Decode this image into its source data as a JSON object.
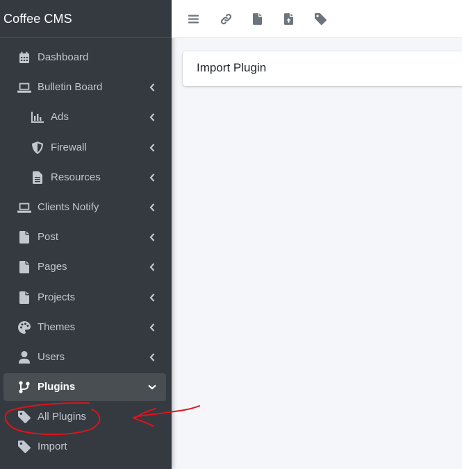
{
  "brand": {
    "title": "Coffee CMS"
  },
  "sidebar": {
    "items": [
      {
        "label": "Dashboard",
        "icon": "calendar-icon"
      },
      {
        "label": "Bulletin Board",
        "icon": "laptop-icon"
      },
      {
        "label": "Ads",
        "icon": "chart-bar-icon"
      },
      {
        "label": "Firewall",
        "icon": "shield-icon"
      },
      {
        "label": "Resources",
        "icon": "file-text-icon"
      },
      {
        "label": "Clients Notify",
        "icon": "laptop-icon"
      },
      {
        "label": "Post",
        "icon": "file-icon"
      },
      {
        "label": "Pages",
        "icon": "file-icon"
      },
      {
        "label": "Projects",
        "icon": "file-icon"
      },
      {
        "label": "Themes",
        "icon": "palette-icon"
      },
      {
        "label": "Users",
        "icon": "user-icon"
      },
      {
        "label": "Plugins",
        "icon": "code-branch-icon"
      },
      {
        "label": "All Plugins",
        "icon": "tag-icon"
      },
      {
        "label": "Import",
        "icon": "tag-icon"
      }
    ]
  },
  "topbar": {
    "icons": [
      "menu-icon",
      "link-icon",
      "file-icon",
      "file-upload-icon",
      "tag-icon"
    ]
  },
  "main": {
    "card_title": "Import Plugin"
  },
  "colors": {
    "sidebar_bg": "#343a40",
    "sidebar_text": "#c2c7d0",
    "active_bg": "#494e53",
    "annotation": "#e0121c"
  }
}
